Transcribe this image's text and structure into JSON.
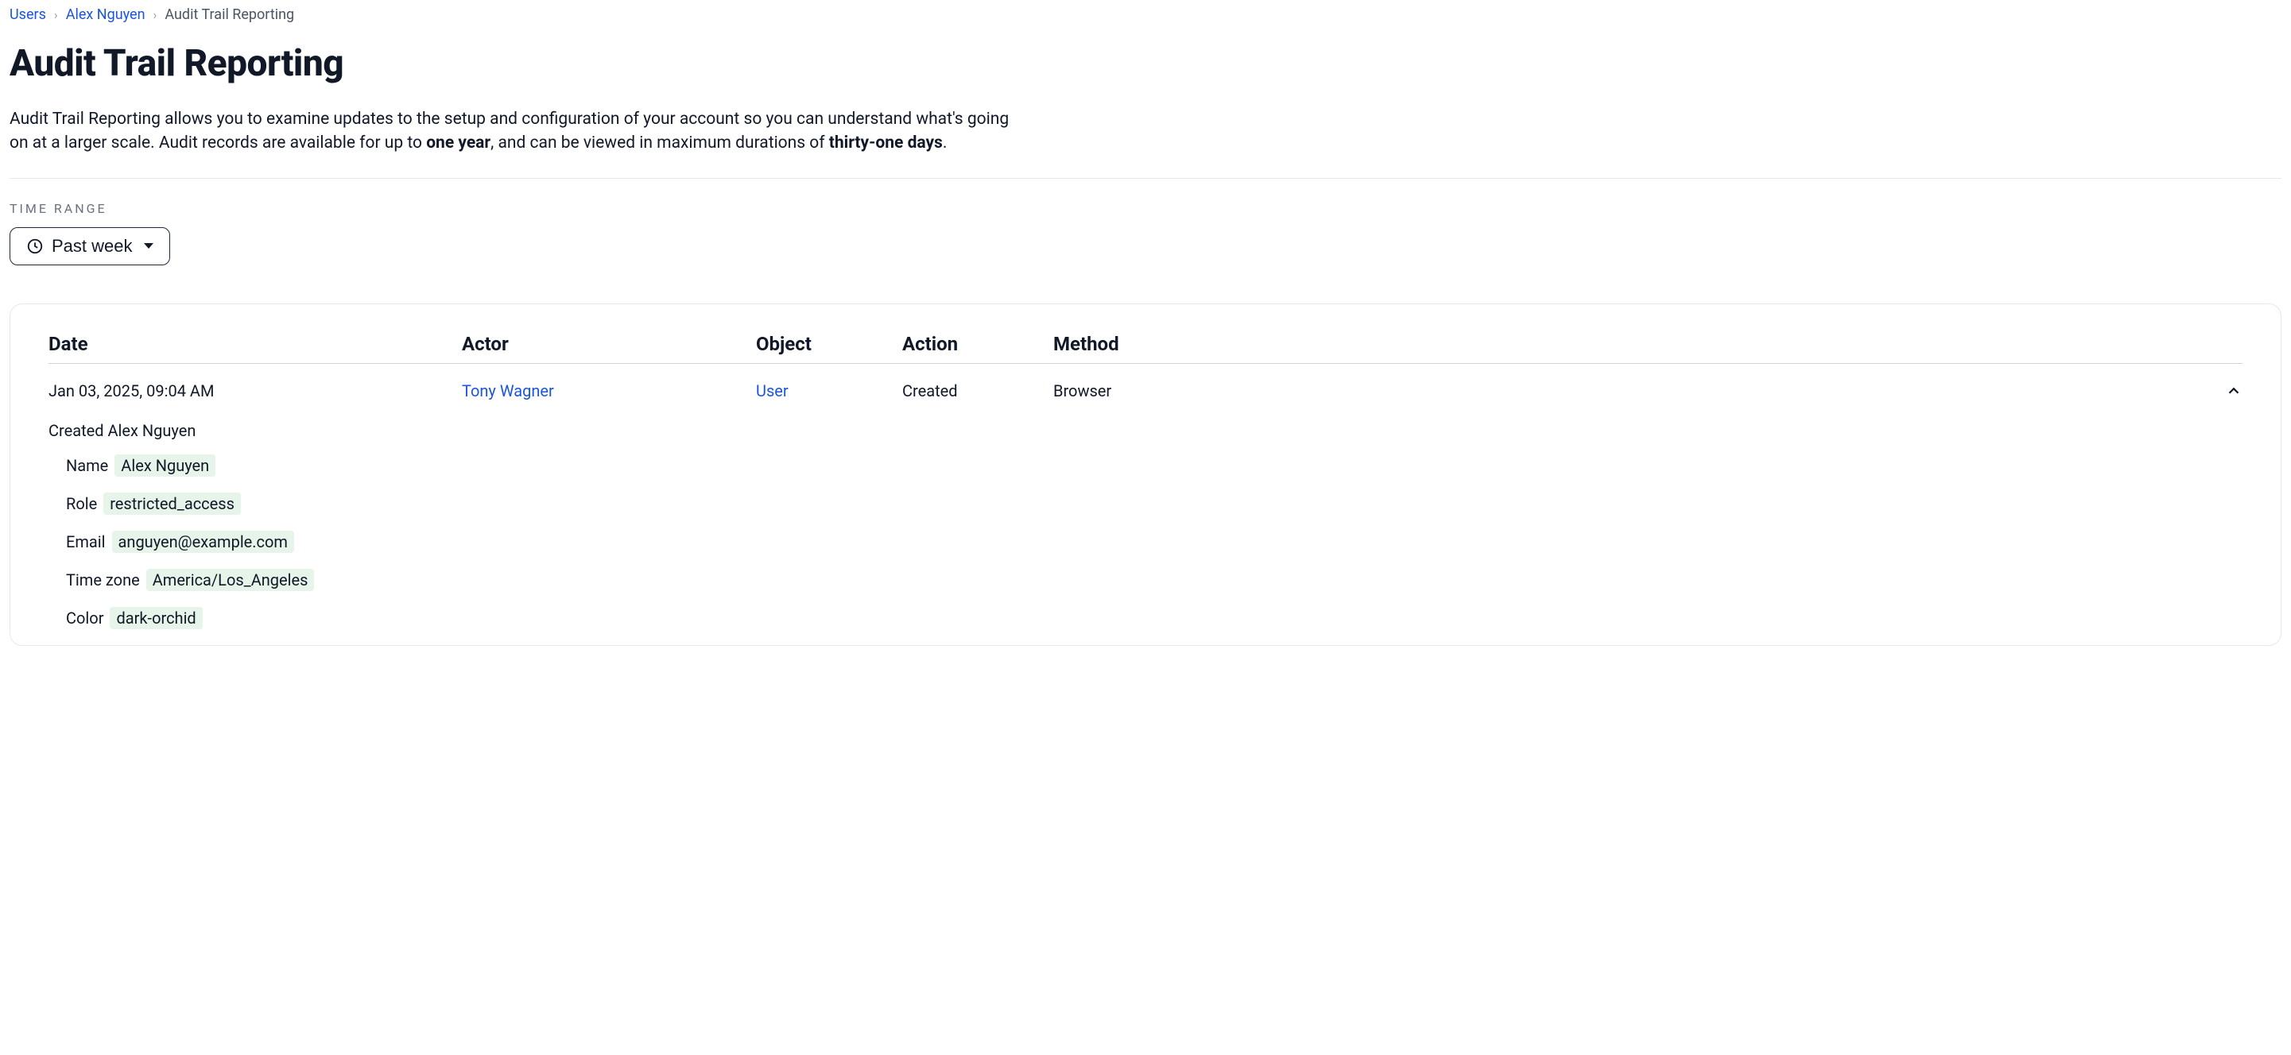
{
  "breadcrumb": {
    "users": "Users",
    "user_name": "Alex Nguyen",
    "current": "Audit Trail Reporting"
  },
  "page_title": "Audit Trail Reporting",
  "description": {
    "part1": "Audit Trail Reporting allows you to examine updates to the setup and configuration of your account so you can understand what's going on at a larger scale. Audit records are available for up to ",
    "bold1": "one year",
    "part2": ", and can be viewed in maximum durations of ",
    "bold2": "thirty-one days",
    "part3": "."
  },
  "time_range": {
    "label": "TIME RANGE",
    "value": "Past week"
  },
  "table": {
    "headers": {
      "date": "Date",
      "actor": "Actor",
      "object": "Object",
      "action": "Action",
      "method": "Method"
    },
    "rows": [
      {
        "date": "Jan 03, 2025, 09:04 AM",
        "actor": "Tony Wagner",
        "object": "User",
        "action": "Created",
        "method": "Browser",
        "detail_title": "Created Alex Nguyen",
        "details": {
          "name_label": "Name",
          "name_value": "Alex Nguyen",
          "role_label": "Role",
          "role_value": "restricted_access",
          "email_label": "Email",
          "email_value": "anguyen@example.com",
          "timezone_label": "Time zone",
          "timezone_value": "America/Los_Angeles",
          "color_label": "Color",
          "color_value": "dark-orchid"
        }
      }
    ]
  }
}
